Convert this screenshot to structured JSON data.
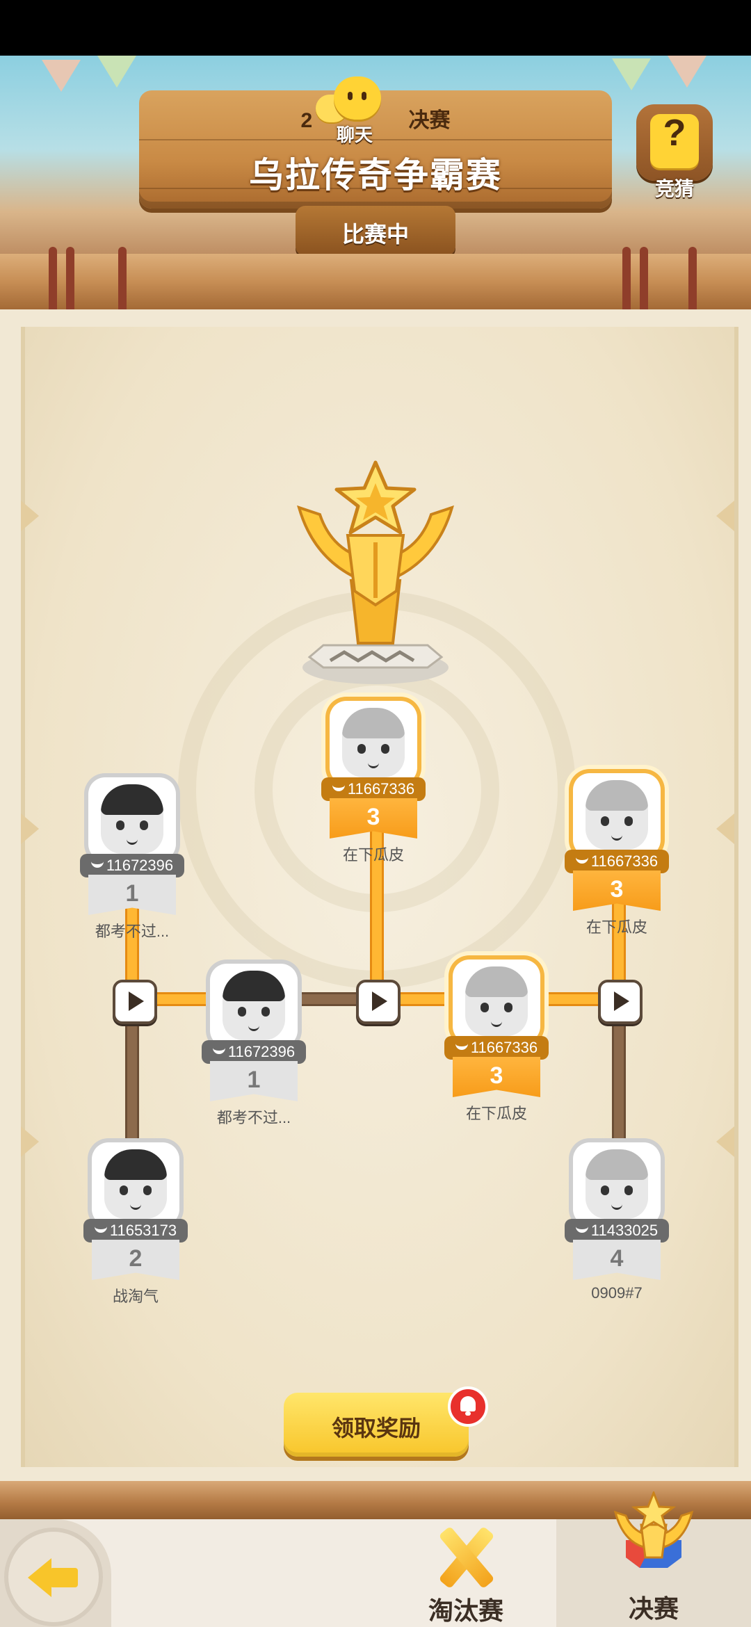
{
  "header": {
    "subtitle_left": "2",
    "subtitle_right": "决赛",
    "title": "乌拉传奇争霸赛",
    "status": "比赛中",
    "chat_label": "聊天",
    "guess_label": "竞猜"
  },
  "bracket": {
    "champion": {
      "score": "11667336",
      "seed": "3",
      "name": "在下瓜皮"
    },
    "semi_left": {
      "score": "11672396",
      "seed": "1",
      "name": "都考不过..."
    },
    "semi_right": {
      "score": "11667336",
      "seed": "3",
      "name": "在下瓜皮"
    },
    "p_top_left": {
      "score": "11672396",
      "seed": "1",
      "name": "都考不过..."
    },
    "p_bottom_left": {
      "score": "11653173",
      "seed": "2",
      "name": "战淘气"
    },
    "p_top_right": {
      "score": "11667336",
      "seed": "3",
      "name": "在下瓜皮"
    },
    "p_bottom_right": {
      "score": "11433025",
      "seed": "4",
      "name": "0909#7"
    }
  },
  "actions": {
    "claim_reward": "领取奖励"
  },
  "tabs": {
    "knockout": "淘汰赛",
    "final": "决赛"
  },
  "colors": {
    "accent": "#f8c52a",
    "win_line": "#ffb733",
    "lose_line": "#8c6a4c"
  }
}
